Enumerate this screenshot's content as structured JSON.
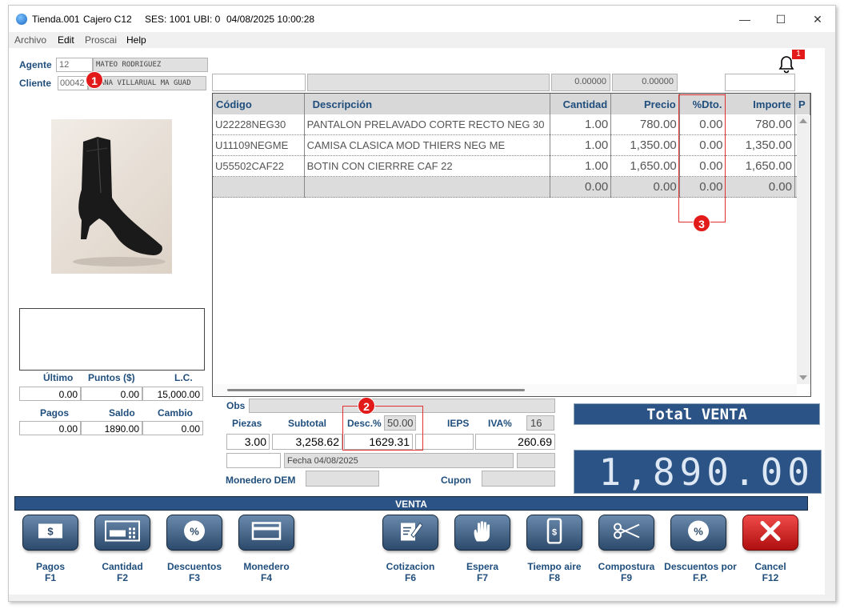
{
  "window": {
    "title_app": "Tienda.001",
    "title_cashier": "Cajero C12",
    "title_session": "SES: 1001",
    "title_ubi": "UBI: 0",
    "title_datetime": "04/08/2025 10:00:28",
    "minimize": "—",
    "maximize": "☐",
    "close": "✕"
  },
  "menu": [
    "Archivo",
    "Edit",
    "Proscai",
    "Help"
  ],
  "header": {
    "agente_label": "Agente",
    "agente_code": "12",
    "agente_name": "MATEO RODRIGUEZ",
    "cliente_label": "Cliente",
    "cliente_code": "00042",
    "cliente_name": "DIANA VILLARUAL MA GUAD",
    "notification_count": "1"
  },
  "grid_top": {
    "field1": "",
    "field2": "",
    "qty_total": "0.00000",
    "price_total": "0.00000",
    "field5": ""
  },
  "table": {
    "columns": [
      "Código",
      "Descripción",
      "Cantidad",
      "Precio",
      "%Dto.",
      "Importe",
      "P"
    ],
    "rows": [
      [
        "U22228NEG30",
        "PANTALON PRELAVADO CORTE RECTO NEG 30",
        "1.00",
        "780.00",
        "0.00",
        "780.00"
      ],
      [
        "U11109NEGME",
        "CAMISA CLASICA MOD THIERS NEG ME",
        "1.00",
        "1,350.00",
        "0.00",
        "1,350.00"
      ],
      [
        "U55502CAF22",
        "BOTIN  CON CIERRRE CAF 22",
        "1.00",
        "1,650.00",
        "0.00",
        "1,650.00"
      ],
      [
        "",
        "",
        "0.00",
        "0.00",
        "0.00",
        "0.00"
      ]
    ]
  },
  "left_panel": {
    "ultimo_label": "Último",
    "puntos_label": "Puntos ($)",
    "lc_label": "L.C.",
    "ultimo": "0.00",
    "puntos": "0.00",
    "lc": "15,000.00",
    "pagos_label": "Pagos",
    "saldo_label": "Saldo",
    "cambio_label": "Cambio",
    "pagos": "0.00",
    "saldo": "1890.00",
    "cambio": "0.00"
  },
  "totals": {
    "obs_label": "Obs",
    "piezas_label": "Piezas",
    "subtotal_label": "Subtotal",
    "desc_label": "Desc.%",
    "desc_pct": "50.00",
    "ieps_label": "IEPS",
    "iva_label": "IVA%",
    "iva_pct": "16",
    "piezas": "3.00",
    "subtotal": "3,258.62",
    "desc_amount": "1629.31",
    "ieps": "",
    "iva": "260.69",
    "fecha": "Fecha 04/08/2025",
    "monedero_label": "Monedero DEM",
    "cupon_label": "Cupon"
  },
  "total_venta": {
    "label": "Total VENTA",
    "value": "1,890.00"
  },
  "venta_bar": "VENTA",
  "callouts": [
    "1",
    "2",
    "3"
  ],
  "fkeys": [
    {
      "label": "Pagos",
      "key": "F1",
      "icon": "money-icon"
    },
    {
      "label": "Cantidad",
      "key": "F2",
      "icon": "calculator-icon"
    },
    {
      "label": "Descuentos",
      "key": "F3",
      "icon": "discount-icon"
    },
    {
      "label": "Monedero",
      "key": "F4",
      "icon": "wallet-card-icon"
    },
    {
      "label": "Cotizacion",
      "key": "F6",
      "icon": "quote-edit-icon"
    },
    {
      "label": "Espera",
      "key": "F7",
      "icon": "hand-stop-icon"
    },
    {
      "label": "Tiempo aire",
      "key": "F8",
      "icon": "phone-icon"
    },
    {
      "label": "Compostura",
      "key": "F9",
      "icon": "scissors-icon"
    },
    {
      "label": "Descuentos por",
      "label2": "F.P.",
      "icon": "discount-icon"
    },
    {
      "label": "Cancel",
      "key": "F12",
      "icon": "cancel-x-icon"
    }
  ],
  "colors": {
    "accent_blue": "#2c5385",
    "label_blue": "#1f4e7d",
    "callout_red": "#e21a1a",
    "cancel_red": "#d11a1a"
  }
}
